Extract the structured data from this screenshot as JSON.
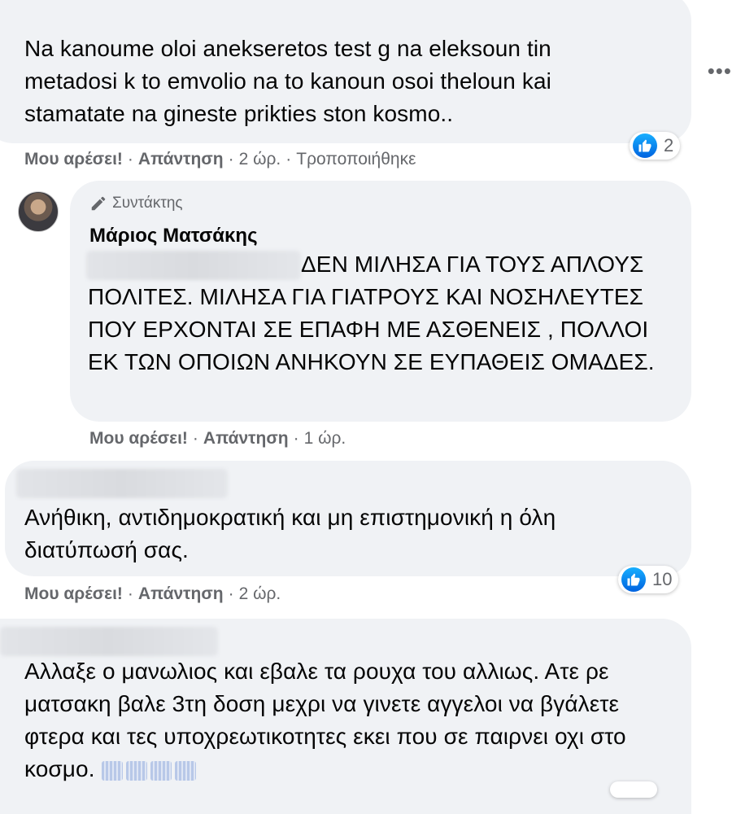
{
  "comments": [
    {
      "text": "Na kanoume oloi anekseretos test g na eleksoun tin metadosi k to emvolio na to kanoun osoi theloun kai stamatate na gineste prikties ston kosmo..",
      "like_label": "Μου αρέσει!",
      "reply_label": "Απάντηση",
      "time": "2 ώρ.",
      "edited_label": "Τροποποιήθηκε",
      "reaction_count": "2"
    },
    {
      "role_label": "Συντάκτης",
      "author": "Μάριος Ματσάκης",
      "text": "ΔΕΝ ΜΙΛΗΣΑ ΓΙΑ ΤΟΥΣ ΑΠΛΟΥΣ ΠΟΛΙΤΕΣ. ΜΙΛΗΣΑ ΓΙΑ ΓΙΑΤΡΟΥΣ ΚΑΙ ΝΟΣΗΛΕΥΤΕΣ ΠΟΥ ΕΡΧΟΝΤΑΙ ΣΕ ΕΠΑΦΗ ΜΕ ΑΣΘΕΝΕΙΣ , ΠΟΛΛΟΙ ΕΚ ΤΩΝ ΟΠΟΙΩΝ ΑΝΗΚΟΥΝ ΣΕ ΕΥΠΑΘΕΙΣ ΟΜΑΔΕΣ.",
      "like_label": "Μου αρέσει!",
      "reply_label": "Απάντηση",
      "time": "1 ώρ."
    },
    {
      "text": "Ανήθικη, αντιδημοκρατική και μη επιστημονική η όλη διατύπωσή σας.",
      "like_label": "Μου αρέσει!",
      "reply_label": "Απάντηση",
      "time": "2 ώρ.",
      "reaction_count": "10"
    },
    {
      "text": "Αλλαξε ο μανωλιος και εβαλε τα ρουχα του αλλιως. Ατε ρε ματσακη βαλε 3τη δοση μεχρι να γινετε αγγελοι να βγάλετε φτερα και τες υποχρεωτικοτητες εκει που σε παιρνει οχι στο κοσμο."
    }
  ],
  "icons": {
    "like": "thumbs-up-icon",
    "more": "more-options-icon",
    "role": "pencil-icon"
  },
  "colors": {
    "bubble": "#f0f2f5",
    "secondary_text": "#65676b",
    "like_blue": "#1877f2"
  }
}
